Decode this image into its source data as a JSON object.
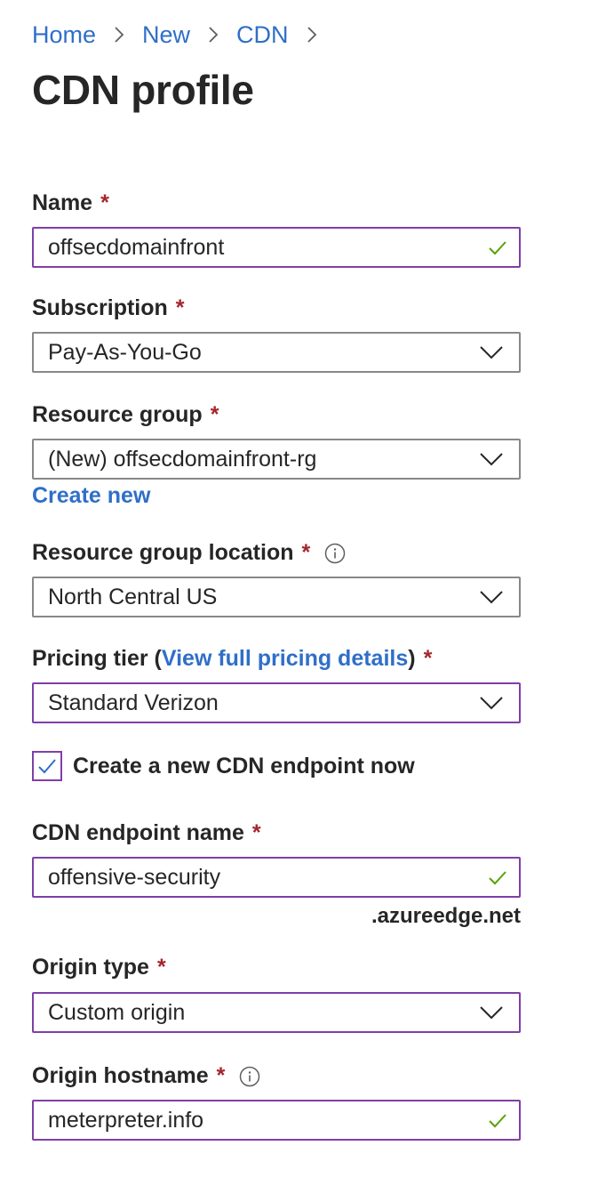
{
  "breadcrumb": [
    "Home",
    "New",
    "CDN"
  ],
  "page_title": "CDN profile",
  "required_mark": "*",
  "name": {
    "label": "Name",
    "value": "offsecdomainfront",
    "valid": true
  },
  "subscription": {
    "label": "Subscription",
    "value": "Pay-As-You-Go"
  },
  "resource_group": {
    "label": "Resource group",
    "value": "(New) offsecdomainfront-rg",
    "create_new": "Create new"
  },
  "resource_group_location": {
    "label": "Resource group location",
    "value": "North Central US"
  },
  "pricing_tier": {
    "label_prefix": "Pricing tier (",
    "link": "View full pricing details",
    "label_suffix": ")",
    "value": "Standard Verizon"
  },
  "create_endpoint": {
    "label": "Create a new CDN endpoint now",
    "checked": true
  },
  "endpoint_name": {
    "label": "CDN endpoint name",
    "value": "offensive-security",
    "suffix": ".azureedge.net",
    "valid": true
  },
  "origin_type": {
    "label": "Origin type",
    "value": "Custom origin"
  },
  "origin_hostname": {
    "label": "Origin hostname",
    "value": "meterpreter.info",
    "valid": true
  },
  "colors": {
    "link": "#2f6fc8",
    "required": "#a4262c",
    "focus_border": "#7f3fa8",
    "valid": "#57a300",
    "border": "#8a8886"
  }
}
